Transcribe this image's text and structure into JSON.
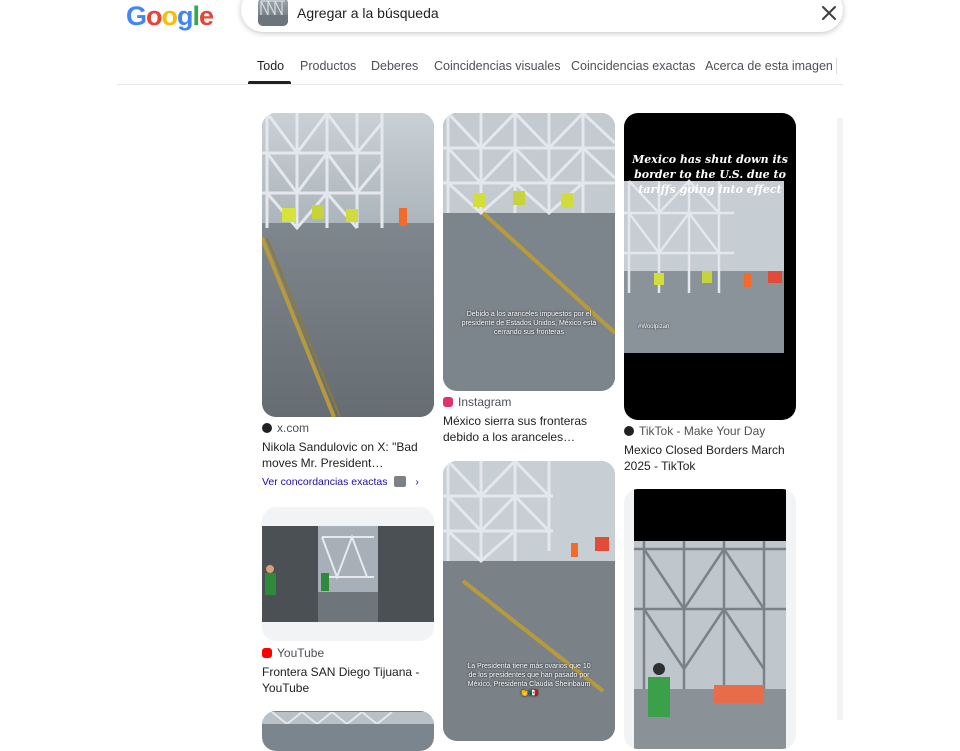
{
  "header": {
    "logo_text": "Google",
    "logo_colors": [
      "#4285F4",
      "#EA4335",
      "#FBBC05",
      "#4285F4",
      "#34A853",
      "#EA4335"
    ],
    "search_text": "Agregar a la búsqueda"
  },
  "tabs": [
    "Todo",
    "Productos",
    "Deberes",
    "Coincidencias visuales",
    "Coincidencias exactas",
    "Acerca de esta imagen"
  ],
  "results": [
    {
      "source": "x.com",
      "title": "Nikola Sandulovic on X: \"Bad moves Mr. President…",
      "link": "Ver concordancias exactas",
      "icon": "x-logo-icon"
    },
    {
      "source": "YouTube",
      "title": "Frontera SAN Diego Tijuana - YouTube",
      "icon": "youtube-icon"
    },
    {
      "source": "Instagram",
      "title": "México sierra sus fronteras debido a los aranceles…",
      "overlay": "Debido a los aranceles impuestos por el presidente de Estados Unidos, México está cerrando sus fronteras",
      "icon": "instagram-icon"
    },
    {
      "overlay": "La Presidenta tiene más ovarios que 10 de los presidentes que han pasado por México, Presidenta Claudia Sheinbaum 👏🇲🇽"
    },
    {
      "source": "TikTok - Make Your Day",
      "title": "Mexico Closed Borders March 2025 - TikTok",
      "overlay": "Mexico has shut down its border to the U.S. due to tariffs going into effect",
      "watermark": "#Woolpizan",
      "icon": "tiktok-icon"
    },
    {
      "icon": "none"
    }
  ],
  "colors": {
    "link": "#1a0dab",
    "youtube": "#ff0000",
    "instagram": "#e1306c"
  }
}
